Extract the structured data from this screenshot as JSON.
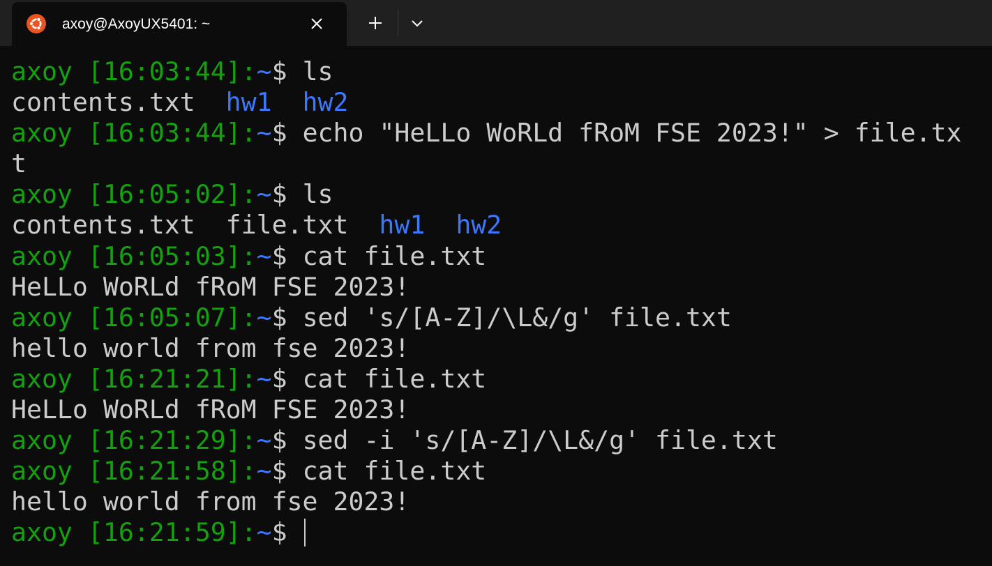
{
  "window": {
    "tab_title": "axoy@AxoyUX5401: ~",
    "tab_icon": "ubuntu-logo-icon",
    "close_icon": "close-icon",
    "new_tab_icon": "plus-icon",
    "dropdown_icon": "chevron-down-icon",
    "colors": {
      "titlebar_bg": "#202020",
      "terminal_bg": "#0c0c0c",
      "prompt_green": "#13a10e",
      "prompt_path_blue": "#3b78ff",
      "dir_blue": "#3b78ff",
      "text": "#cccccc",
      "ubuntu_orange": "#e95420"
    }
  },
  "terminal": {
    "lines": [
      {
        "type": "prompt",
        "user": "axoy",
        "time": "[16:03:44]",
        "sep": ":",
        "path": "~",
        "sigil": "$",
        "cmd": " ls"
      },
      {
        "type": "ls",
        "files": [
          "contents.txt"
        ],
        "dirs": [
          "hw1",
          "hw2"
        ]
      },
      {
        "type": "prompt",
        "user": "axoy",
        "time": "[16:03:44]",
        "sep": ":",
        "path": "~",
        "sigil": "$",
        "cmd": " echo \"HeLLo WoRLd fRoM FSE 2023!\" > file.tx"
      },
      {
        "type": "output",
        "text": "t"
      },
      {
        "type": "prompt",
        "user": "axoy",
        "time": "[16:05:02]",
        "sep": ":",
        "path": "~",
        "sigil": "$",
        "cmd": " ls"
      },
      {
        "type": "ls",
        "files": [
          "contents.txt",
          "file.txt"
        ],
        "dirs": [
          "hw1",
          "hw2"
        ]
      },
      {
        "type": "prompt",
        "user": "axoy",
        "time": "[16:05:03]",
        "sep": ":",
        "path": "~",
        "sigil": "$",
        "cmd": " cat file.txt"
      },
      {
        "type": "output",
        "text": "HeLLo WoRLd fRoM FSE 2023!"
      },
      {
        "type": "prompt",
        "user": "axoy",
        "time": "[16:05:07]",
        "sep": ":",
        "path": "~",
        "sigil": "$",
        "cmd": " sed 's/[A-Z]/\\L&/g' file.txt"
      },
      {
        "type": "output",
        "text": "hello world from fse 2023!"
      },
      {
        "type": "prompt",
        "user": "axoy",
        "time": "[16:21:21]",
        "sep": ":",
        "path": "~",
        "sigil": "$",
        "cmd": " cat file.txt"
      },
      {
        "type": "output",
        "text": "HeLLo WoRLd fRoM FSE 2023!"
      },
      {
        "type": "prompt",
        "user": "axoy",
        "time": "[16:21:29]",
        "sep": ":",
        "path": "~",
        "sigil": "$",
        "cmd": " sed -i 's/[A-Z]/\\L&/g' file.txt"
      },
      {
        "type": "prompt",
        "user": "axoy",
        "time": "[16:21:58]",
        "sep": ":",
        "path": "~",
        "sigil": "$",
        "cmd": " cat file.txt"
      },
      {
        "type": "output",
        "text": "hello world from fse 2023!"
      },
      {
        "type": "prompt",
        "user": "axoy",
        "time": "[16:21:59]",
        "sep": ":",
        "path": "~",
        "sigil": "$",
        "cmd": " ",
        "cursor": true
      }
    ]
  }
}
